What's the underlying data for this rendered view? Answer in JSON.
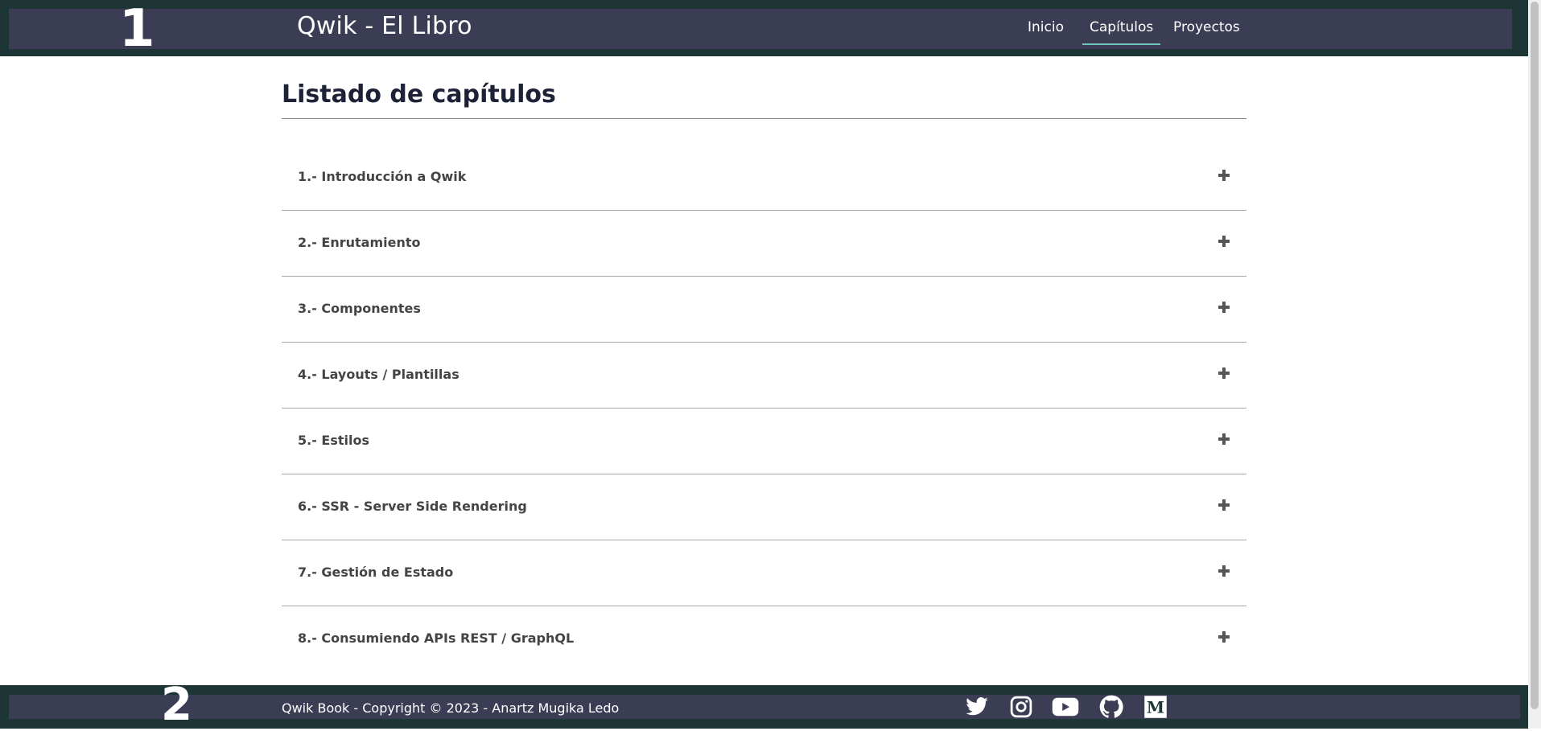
{
  "annotations": {
    "one": "1",
    "two": "2"
  },
  "header": {
    "title": "Qwik - El Libro",
    "nav": [
      {
        "label": "Inicio",
        "active": false
      },
      {
        "label": "Capítulos",
        "active": true
      },
      {
        "label": "Proyectos",
        "active": false
      }
    ]
  },
  "main": {
    "title": "Listado de capítulos",
    "chapters": [
      {
        "label": "1.- Introducción a Qwik",
        "icon": "plus-icon"
      },
      {
        "label": "2.- Enrutamiento",
        "icon": "plus-icon"
      },
      {
        "label": "3.- Componentes",
        "icon": "plus-icon"
      },
      {
        "label": "4.- Layouts / Plantillas",
        "icon": "plus-icon"
      },
      {
        "label": "5.- Estilos",
        "icon": "plus-icon"
      },
      {
        "label": "6.- SSR - Server Side Rendering",
        "icon": "plus-icon"
      },
      {
        "label": "7.- Gestión de Estado",
        "icon": "plus-icon"
      },
      {
        "label": "8.- Consumiendo APIs REST / GraphQL",
        "icon": "plus-icon"
      }
    ]
  },
  "footer": {
    "copyright": "Qwik Book - Copyright © 2023 - Anartz Mugika Ledo",
    "social": [
      "twitter-icon",
      "instagram-icon",
      "youtube-icon",
      "github-icon",
      "medium-icon"
    ]
  },
  "colors": {
    "header_bg": "#1e3536",
    "bar_bg": "#3b3d54",
    "active_underline": "#6fc7c0",
    "heading": "#1d2236"
  }
}
